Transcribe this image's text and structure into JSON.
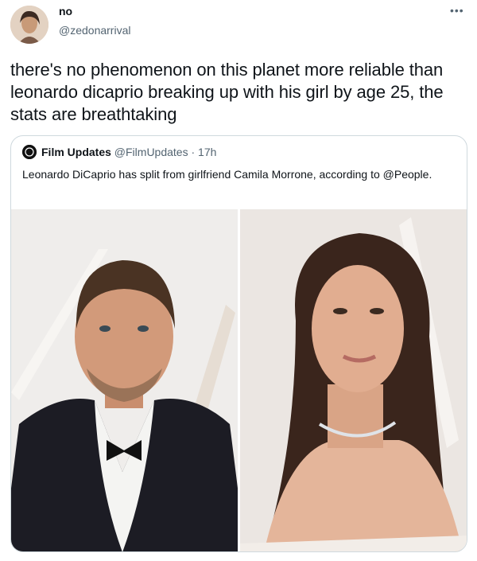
{
  "tweet": {
    "display_name": "no",
    "handle": "@zedonarrival",
    "more_icon": "more-horizontal-icon",
    "text": "there's no phenomenon on this planet more reliable than leonardo dicaprio breaking up with his girl by age 25, the stats are breathtaking"
  },
  "quoted": {
    "display_name": "Film Updates",
    "handle": "@FilmUpdates",
    "separator": "·",
    "time": "17h",
    "text": "Leonardo DiCaprio has split from girlfriend Camila Morrone, according to @People."
  },
  "colors": {
    "text_primary": "#0f1419",
    "text_secondary": "#536471",
    "border": "#cfd9de"
  }
}
